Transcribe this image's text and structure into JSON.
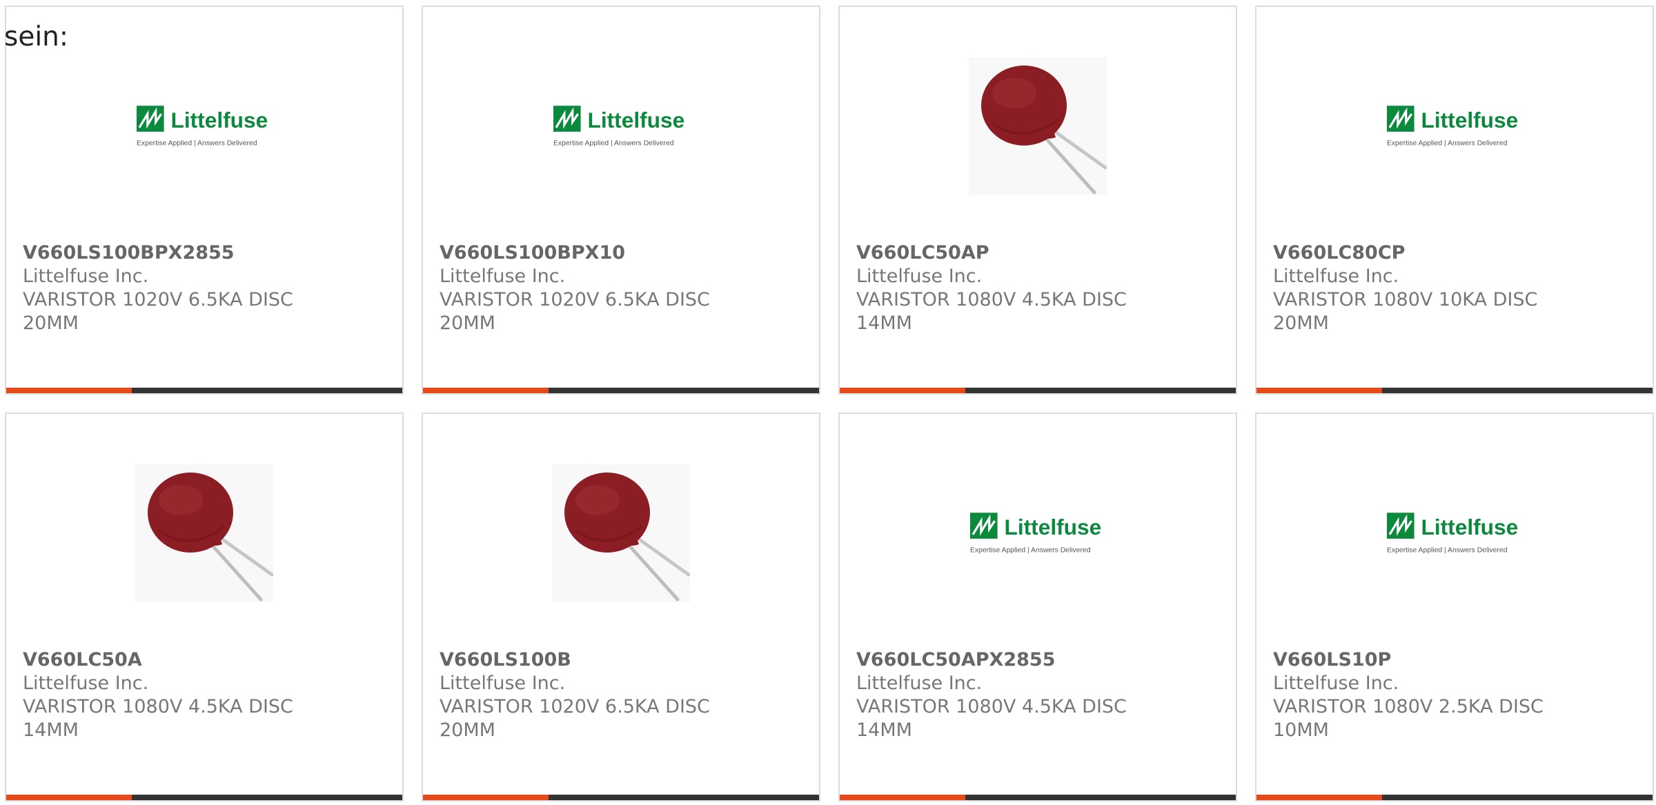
{
  "intro_text": "sein:",
  "colors": {
    "accent": "#e64a19",
    "bar_dark": "#333333",
    "brand_green": "#0b8a3e",
    "varistor_red": "#8b1e24"
  },
  "products": [
    {
      "part_number": "V660LS100BPX2855",
      "manufacturer": "Littelfuse Inc.",
      "description": "VARISTOR 1020V 6.5KA DISC 20MM",
      "image": "littelfuse-logo",
      "logo_text": "Littelfuse",
      "logo_tagline": "Expertise Applied | Answers Delivered"
    },
    {
      "part_number": "V660LS100BPX10",
      "manufacturer": "Littelfuse Inc.",
      "description": "VARISTOR 1020V 6.5KA DISC 20MM",
      "image": "littelfuse-logo",
      "logo_text": "Littelfuse",
      "logo_tagline": "Expertise Applied | Answers Delivered"
    },
    {
      "part_number": "V660LC50AP",
      "manufacturer": "Littelfuse Inc.",
      "description": "VARISTOR 1080V 4.5KA DISC 14MM",
      "image": "varistor-photo"
    },
    {
      "part_number": "V660LC80CP",
      "manufacturer": "Littelfuse Inc.",
      "description": "VARISTOR 1080V 10KA DISC 20MM",
      "image": "littelfuse-logo",
      "logo_text": "Littelfuse",
      "logo_tagline": "Expertise Applied | Answers Delivered"
    },
    {
      "part_number": "V660LC50A",
      "manufacturer": "Littelfuse Inc.",
      "description": "VARISTOR 1080V 4.5KA DISC 14MM",
      "image": "varistor-photo"
    },
    {
      "part_number": "V660LS100B",
      "manufacturer": "Littelfuse Inc.",
      "description": "VARISTOR 1020V 6.5KA DISC 20MM",
      "image": "varistor-photo"
    },
    {
      "part_number": "V660LC50APX2855",
      "manufacturer": "Littelfuse Inc.",
      "description": "VARISTOR 1080V 4.5KA DISC 14MM",
      "image": "littelfuse-logo",
      "logo_text": "Littelfuse",
      "logo_tagline": "Expertise Applied | Answers Delivered"
    },
    {
      "part_number": "V660LS10P",
      "manufacturer": "Littelfuse Inc.",
      "description": "VARISTOR 1080V 2.5KA DISC 10MM",
      "image": "littelfuse-logo",
      "logo_text": "Littelfuse",
      "logo_tagline": "Expertise Applied | Answers Delivered"
    }
  ]
}
